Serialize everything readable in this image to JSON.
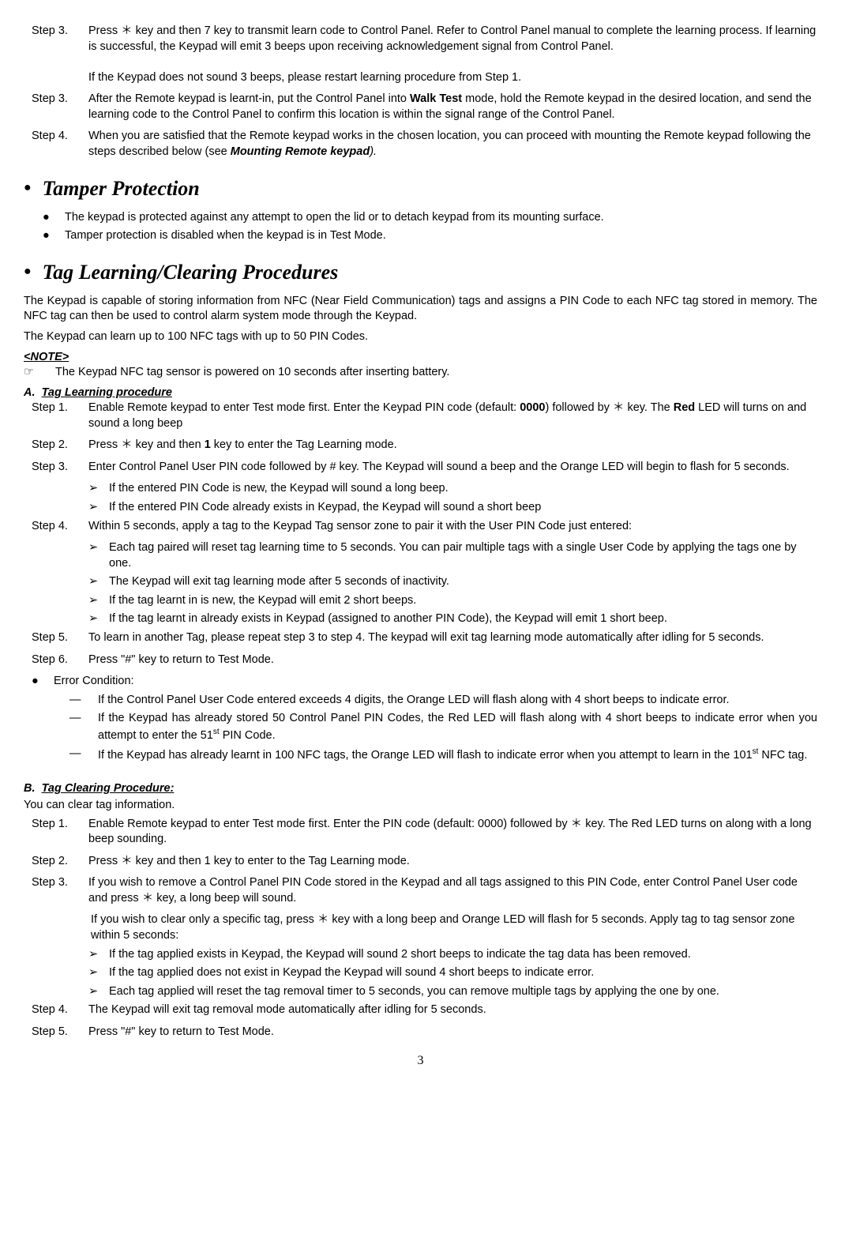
{
  "initial_steps": {
    "s3a_label": "Step 3.",
    "s3a_text": "Press ＊ key and then 7 key to transmit learn code to Control Panel. Refer to Control Panel manual to complete the learning process. If learning is successful, the Keypad will emit 3 beeps upon receiving acknowledgement signal from Control Panel.",
    "s3a_text2": "If the Keypad does not sound 3 beeps, please restart learning procedure from Step 1.",
    "s3b_label": "Step 3.",
    "s3b_pre": "After the Remote keypad is learnt-in, put the Control Panel into ",
    "s3b_bold": "Walk Test",
    "s3b_post": " mode, hold the Remote keypad in the desired location, and send the learning code to the Control Panel to confirm this location is within the signal range of the Control Panel.",
    "s4_label": "Step 4.",
    "s4_pre": "When you are satisfied that the Remote keypad works in the chosen location, you can proceed with mounting the Remote keypad following the steps described below (see ",
    "s4_bold": "Mounting Remote keypad",
    "s4_post": ")."
  },
  "tamper": {
    "heading": "Tamper Protection",
    "b1": "The keypad is protected against any attempt to open the lid or to detach keypad from its mounting surface.",
    "b2": "Tamper protection is disabled when the keypad is in Test Mode."
  },
  "tag": {
    "heading": "Tag Learning/Clearing Procedures",
    "p1": "The Keypad is capable of storing information from NFC (Near Field Communication) tags and assigns a PIN Code to each NFC tag stored in memory. The NFC tag can then be used to control alarm system mode through the Keypad.",
    "p2": "The Keypad can learn up to 100 NFC tags with up to 50 PIN Codes.",
    "note_head": "<NOTE>",
    "note1": "The Keypad NFC tag sensor is powered on 10 seconds after inserting battery."
  },
  "learnA": {
    "title_letter": "A.",
    "title_text": "Tag Learning procedure",
    "s1_label": "Step 1.",
    "s1_pre": "Enable Remote keypad to enter Test mode first. Enter the Keypad PIN code (default: ",
    "s1_bold1": "0000",
    "s1_mid": ") followed by ＊ key. The ",
    "s1_bold2": "Red",
    "s1_post": " LED will turns on and sound a long beep",
    "s2_label": "Step 2.",
    "s2_pre": "Press ＊ key and then ",
    "s2_bold": "1",
    "s2_post": " key to enter the Tag Learning mode.",
    "s3_label": "Step 3.",
    "s3_text": "Enter Control Panel User PIN code followed by # key. The Keypad will sound a beep and the Orange LED will begin to flash for 5 seconds.",
    "s3_a1": "If the entered PIN Code is new, the Keypad will sound a long beep.",
    "s3_a2": "If the entered PIN Code already exists in Keypad, the Keypad will sound a short beep",
    "s4_label": "Step 4.",
    "s4_text": "Within 5 seconds, apply a tag to the Keypad Tag sensor zone to pair it with the User PIN Code just entered:",
    "s4_a1": "Each tag paired will reset tag learning time to 5 seconds. You can pair multiple tags with a single User Code by applying the tags one by one.",
    "s4_a2": "The Keypad will exit tag learning mode after 5 seconds of inactivity.",
    "s4_a3": "If the tag learnt in is new, the Keypad will emit 2 short beeps.",
    "s4_a4": "If the tag learnt in already exists in Keypad (assigned to another PIN Code), the Keypad will emit 1 short beep.",
    "s5_label": "Step 5.",
    "s5_text": "To learn in another Tag, please repeat step 3 to step 4. The keypad will exit tag learning mode automatically after idling for 5 seconds.",
    "s6_label": "Step 6.",
    "s6_text": "Press \"#\" key to return to Test Mode.",
    "err_label": "Error Condition:",
    "err1": "If the Control Panel User Code entered exceeds 4 digits, the Orange LED will flash along with 4 short beeps to indicate error.",
    "err2_pre": "If the Keypad has already stored 50 Control Panel PIN Codes, the Red LED will flash along with 4 short beeps to indicate error when you attempt to enter the 51",
    "err2_sup": "st",
    "err2_post": " PIN Code.",
    "err3_pre": "If the Keypad has already learnt in 100 NFC tags, the Orange LED will flash to indicate error when you attempt to learn in the 101",
    "err3_sup": "st",
    "err3_post": " NFC tag."
  },
  "clearB": {
    "title_letter": "B.",
    "title_text": "Tag Clearing Procedure:",
    "intro": "You can clear tag information.",
    "s1_label": "Step 1.",
    "s1_text": "Enable Remote keypad to enter Test mode first. Enter the PIN code (default: 0000) followed by ＊ key.   The Red LED turns on along with a long beep sounding.",
    "s2_label": "Step 2.",
    "s2_text": "Press ＊ key and then 1 key to enter to the Tag Learning mode.",
    "s3_label": "Step 3.",
    "s3_text": "If you wish to remove a Control Panel PIN Code stored in the Keypad and all tags assigned to this PIN Code, enter Control Panel User code and press ＊ key, a long beep will sound.",
    "s3_p2": "If you wish to clear only a specific tag, press ＊ key with a long beep and Orange LED will flash for 5 seconds. Apply tag to tag sensor zone within 5 seconds:",
    "s3_a1": "If the tag applied exists in Keypad, the Keypad will sound 2 short beeps to indicate the tag data has been removed.",
    "s3_a2": "If the tag applied does not exist in Keypad the Keypad will sound 4 short beeps to indicate error.",
    "s3_a3": "Each tag applied will reset the tag removal timer to 5 seconds, you can remove multiple tags by applying the one by one.",
    "s4_label": "Step 4.",
    "s4_text": "The Keypad will exit tag removal mode automatically after idling for 5 seconds.",
    "s5_label": "Step 5.",
    "s5_text": "Press \"#\" key to return to Test Mode."
  },
  "page_number": "3"
}
